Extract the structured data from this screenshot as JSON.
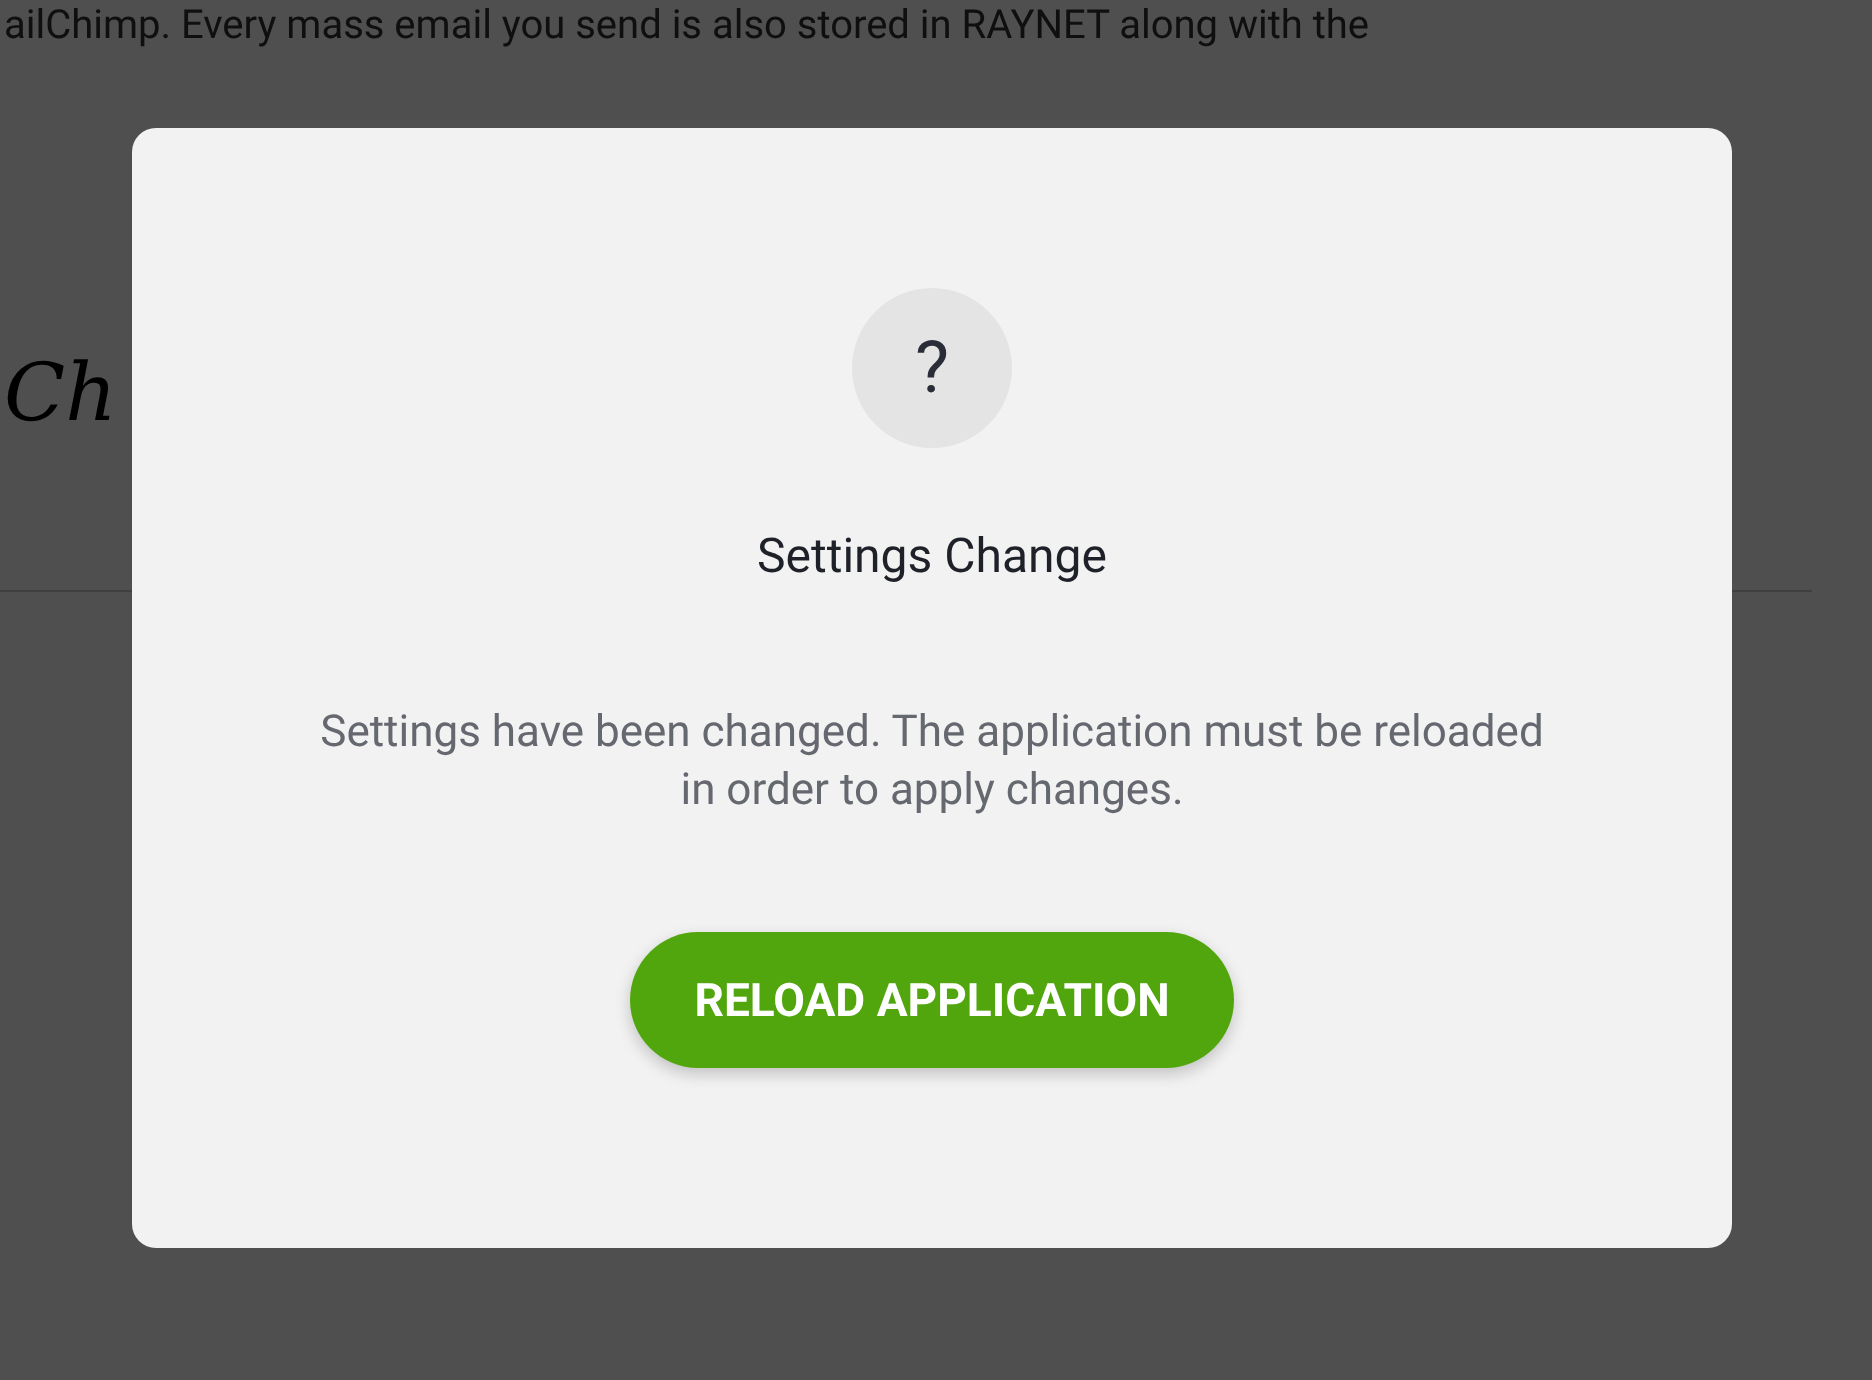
{
  "background_page": {
    "intro_text": "ailChimp. Every mass email you send is also stored in RAYNET along with the",
    "signature": "Ch"
  },
  "dialog": {
    "icon": "?",
    "title": "Settings Change",
    "message": "Settings have been changed. The application must be reloaded in order to apply changes.",
    "button": "RELOAD APPLICATION"
  }
}
